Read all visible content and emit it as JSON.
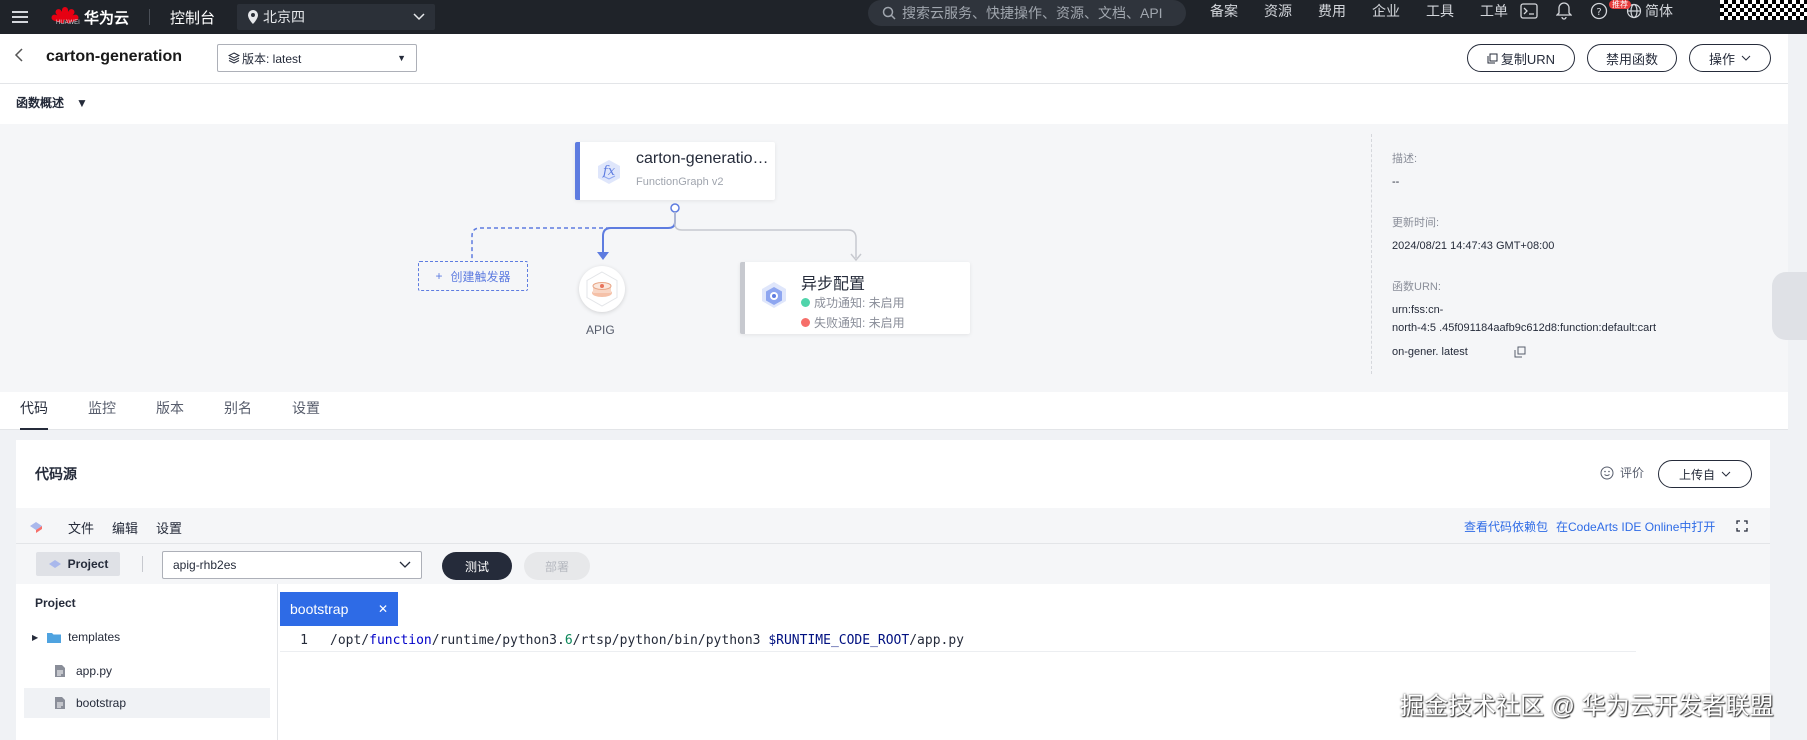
{
  "topbar": {
    "brand": "华为云",
    "brand_sub": "HUAWEI",
    "console": "控制台",
    "region": "北京四",
    "search_placeholder": "搜索云服务、快捷操作、资源、文档、API",
    "nav": [
      "备案",
      "资源",
      "费用",
      "企业",
      "工具",
      "工单"
    ],
    "badge": "推荐",
    "lang": "简体"
  },
  "header": {
    "function_name": "carton-generation",
    "version": "版本: latest",
    "copy_urn": "复制URN",
    "disable": "禁用函数",
    "actions": "操作"
  },
  "overview": {
    "title": "函数概述",
    "fn_card": {
      "title": "carton-generatio…",
      "subtitle": "FunctionGraph v2"
    },
    "create_trigger": "创建触发器",
    "apig_label": "APIG",
    "async": {
      "title": "异步配置",
      "success": "成功通知:  未启用",
      "failure": "失败通知:  未启用"
    },
    "info": {
      "desc_label": "描述:",
      "desc_value": "--",
      "updated_label": "更新时间:",
      "updated_value": "2024/08/21 14:47:43 GMT+08:00",
      "urn_label": "函数URN:",
      "urn_line1": "urn:fss:cn-",
      "urn_line2": "north-4:5                .45f091184aafb9c612d8:function:default:cart",
      "urn_line3": "on-gener.           latest"
    }
  },
  "tabs": [
    "代码",
    "监控",
    "版本",
    "别名",
    "设置"
  ],
  "code": {
    "title": "代码源",
    "rate": "评价",
    "upload": "上传自",
    "menu": [
      "文件",
      "编辑",
      "设置"
    ],
    "links": [
      "查看代码依赖包",
      "在CodeArts IDE Online中打开"
    ],
    "project_btn": "Project",
    "select_value": "apig-rhb2es",
    "test": "测试",
    "deploy": "部署",
    "panel_title": "Project",
    "tree": [
      "templates",
      "app.py",
      "bootstrap"
    ],
    "editor_tab": "bootstrap",
    "line_number": "1",
    "code_parts": {
      "p1": "/opt/",
      "p2": "function",
      "p3": "/runtime/python3.",
      "p4": "6",
      "p5": "/rtsp/python/bin/python3 ",
      "p6": "$RUNTIME_CODE_ROOT",
      "p7": "/app.py"
    }
  },
  "watermark": "掘金技术社区 @ 华为云开发者联盟",
  "colors": {
    "accent": "#5e7ce0",
    "link": "#2e6be6",
    "topbar": "#1f2329",
    "success": "#50d4ab",
    "danger": "#f66f6a"
  }
}
